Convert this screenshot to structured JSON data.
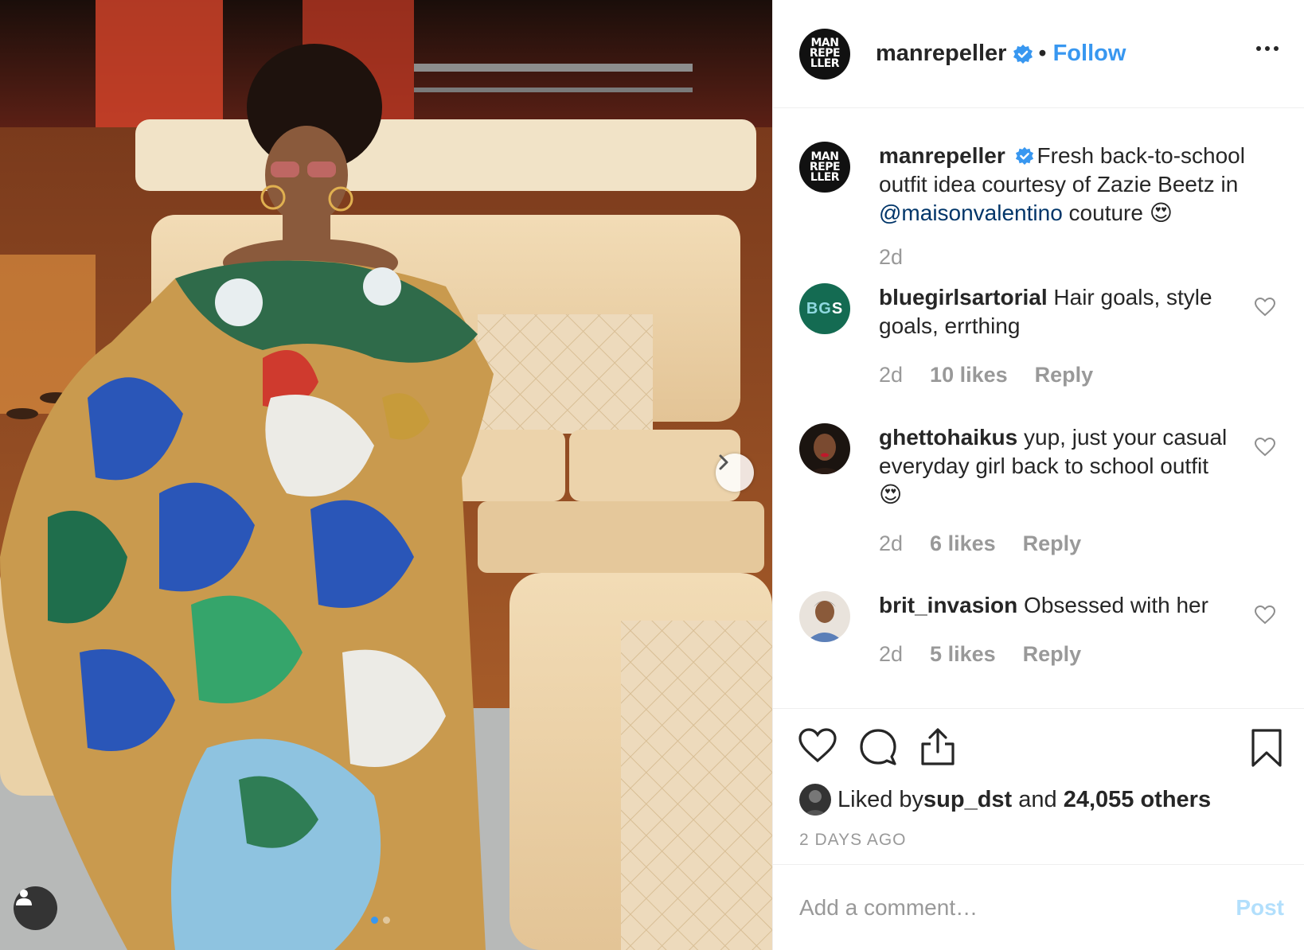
{
  "post": {
    "author": "manrepeller",
    "avatar_text": [
      "MAN",
      "REPE",
      "LLER"
    ],
    "follow_label": "Follow",
    "separator": "•"
  },
  "caption": {
    "username": "manrepeller",
    "text_before": "Fresh back-to-school outfit idea courtesy of Zazie Beetz in ",
    "mention": "@maisonvalentino",
    "text_after": " couture ",
    "emoji": "😍",
    "time": "2d"
  },
  "comments": [
    {
      "username": "bluegirlsartorial",
      "text": "Hair goals, style goals, errthing",
      "time": "2d",
      "likes": "10 likes",
      "reply": "Reply",
      "avatar": "BGS"
    },
    {
      "username": "ghettohaikus",
      "text": "yup, just your casual everyday girl back to school outfit",
      "emoji": "😍",
      "time": "2d",
      "likes": "6 likes",
      "reply": "Reply"
    },
    {
      "username": "brit_invasion",
      "text": "Obsessed with her",
      "time": "2d",
      "likes": "5 likes",
      "reply": "Reply"
    }
  ],
  "likes": {
    "prefix": "Liked by ",
    "user": "sup_dst",
    "middle": " and ",
    "count": "24,055 others"
  },
  "time_ago": "2 DAYS AGO",
  "add_comment": {
    "placeholder": "Add a comment…",
    "post_label": "Post"
  },
  "carousel": {
    "total": 2,
    "active": 0
  },
  "colors": {
    "link_blue": "#3897f0",
    "mention_blue": "#003569",
    "muted": "#999999",
    "post_disabled": "#b2dffc"
  },
  "icons": [
    "verified-icon",
    "more-options-icon",
    "heart-icon",
    "comment-icon",
    "share-icon",
    "bookmark-icon",
    "next-arrow-icon",
    "user-tag-icon"
  ]
}
